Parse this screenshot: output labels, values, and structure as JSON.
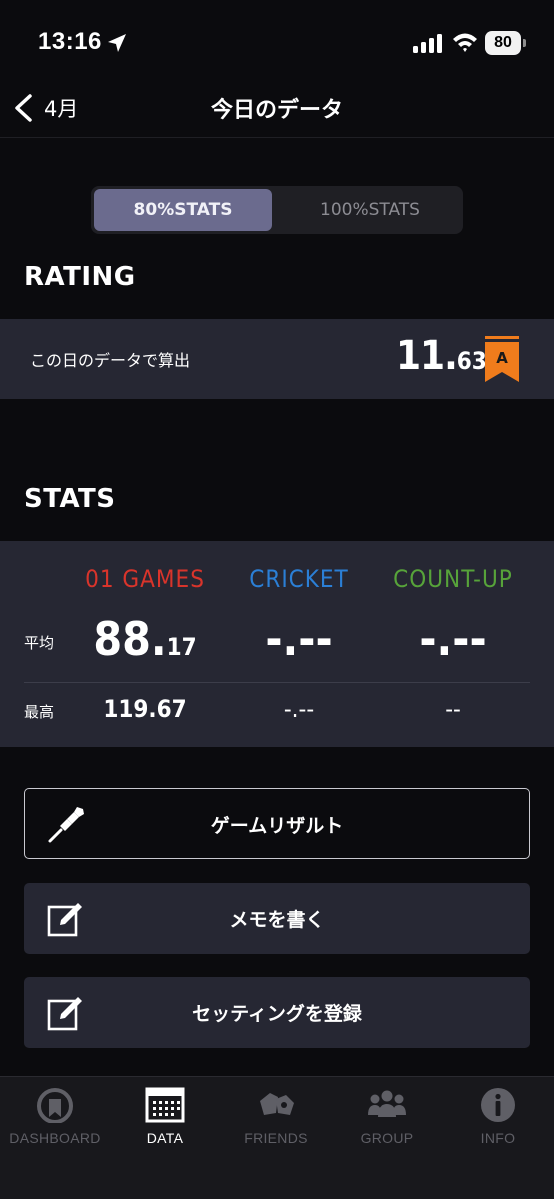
{
  "status_bar": {
    "time": "13:16",
    "battery": "80"
  },
  "nav": {
    "back_label": "4月",
    "title": "今日のデータ"
  },
  "segment": {
    "active": "80%STATS",
    "inactive": "100%STATS"
  },
  "rating": {
    "section_title": "RATING",
    "description": "この日のデータで算出",
    "value_int": "11.",
    "value_dec": "63",
    "badge": "A",
    "badge_color": "#f07c1c"
  },
  "stats": {
    "section_title": "STATS",
    "columns": [
      {
        "label": "01 GAMES",
        "color": "#d9342b",
        "avg_int": "88.",
        "avg_dec": "17",
        "max": "119.67"
      },
      {
        "label": "CRICKET",
        "color": "#2b7fd6",
        "avg_int": "-.--",
        "avg_dec": "",
        "max": "-.--"
      },
      {
        "label": "COUNT-UP",
        "color": "#57a33a",
        "avg_int": "-.--",
        "avg_dec": "",
        "max": "--"
      }
    ],
    "row_avg_label": "平均",
    "row_max_label": "最高"
  },
  "actions": {
    "game_result": "ゲームリザルト",
    "write_memo": "メモを書く",
    "register_setting": "セッティングを登録"
  },
  "tabs": [
    {
      "label": "DASHBOARD",
      "icon": "dashboard-icon",
      "active": false
    },
    {
      "label": "DATA",
      "icon": "calendar-icon",
      "active": true
    },
    {
      "label": "FRIENDS",
      "icon": "friends-icon",
      "active": false
    },
    {
      "label": "GROUP",
      "icon": "group-icon",
      "active": false
    },
    {
      "label": "INFO",
      "icon": "info-icon",
      "active": false
    }
  ]
}
